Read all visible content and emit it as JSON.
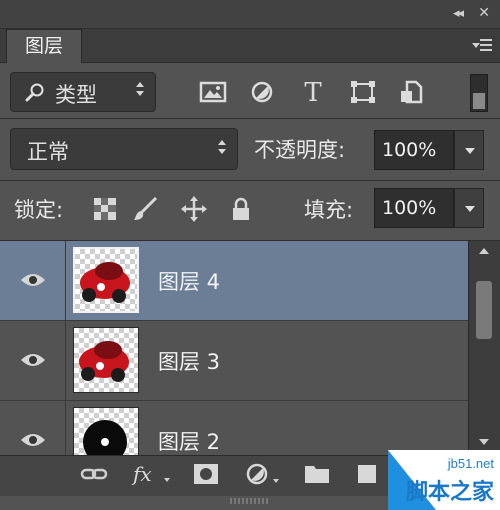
{
  "panel": {
    "tab_label": "图层",
    "collapse_glyph": "◂◂",
    "close_glyph": "✕"
  },
  "filter": {
    "selected": "类型",
    "icons": [
      "image-filter-icon",
      "adjustment-filter-icon",
      "type-filter-icon",
      "shape-filter-icon",
      "smart-object-filter-icon"
    ],
    "type_glyph": "T"
  },
  "blend": {
    "mode": "正常"
  },
  "opacity": {
    "label": "不透明度:",
    "value": "100%"
  },
  "lock": {
    "label": "锁定:"
  },
  "fill": {
    "label": "填充:",
    "value": "100%"
  },
  "layers": [
    {
      "name": "图层 4",
      "selected": true,
      "thumb": "red-car"
    },
    {
      "name": "图层 3",
      "selected": false,
      "thumb": "red-car"
    },
    {
      "name": "图层 2",
      "selected": false,
      "thumb": "black-circle"
    }
  ],
  "bottom_icons": [
    "link-icon",
    "fx-icon",
    "mask-icon",
    "adjustment-icon",
    "folder-icon",
    "new-layer-icon",
    "trash-icon"
  ],
  "fx_label": "fx",
  "watermark": {
    "site": "jb51.net",
    "text": "脚本之家"
  },
  "colors": {
    "selected_row": "#6b7e96",
    "panel_bg": "#535353"
  }
}
